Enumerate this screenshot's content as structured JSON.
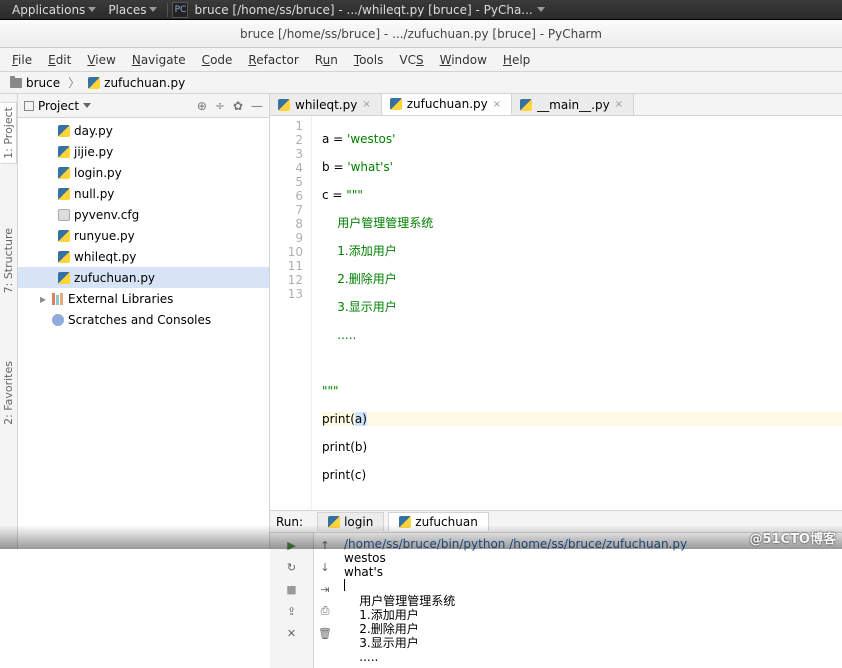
{
  "sysbar": {
    "applications": "Applications",
    "places": "Places",
    "wintitle": "bruce [/home/ss/bruce] - .../whileqt.py [bruce] - PyCha..."
  },
  "titlebar": "bruce [/home/ss/bruce] - .../zufuchuan.py [bruce] - PyCharm",
  "menu": [
    "File",
    "Edit",
    "View",
    "Navigate",
    "Code",
    "Refactor",
    "Run",
    "Tools",
    "VCS",
    "Window",
    "Help"
  ],
  "breadcrumb": {
    "root": "bruce",
    "file": "zufuchuan.py"
  },
  "vtabs": {
    "project": "1: Project",
    "structure": "7: Structure",
    "favorites": "2: Favorites"
  },
  "project": {
    "title": "Project",
    "items": [
      {
        "icon": "py",
        "label": "day.py"
      },
      {
        "icon": "py",
        "label": "jijie.py"
      },
      {
        "icon": "py",
        "label": "login.py"
      },
      {
        "icon": "py",
        "label": "null.py"
      },
      {
        "icon": "cfg",
        "label": "pyvenv.cfg"
      },
      {
        "icon": "py",
        "label": "runyue.py"
      },
      {
        "icon": "py",
        "label": "whileqt.py"
      },
      {
        "icon": "py",
        "label": "zufuchuan.py",
        "selected": true
      }
    ],
    "ext_lib": "External Libraries",
    "scratches": "Scratches and Consoles"
  },
  "editor_tabs": [
    {
      "label": "whileqt.py"
    },
    {
      "label": "zufuchuan.py",
      "active": true
    },
    {
      "label": "__main__.py"
    }
  ],
  "code": {
    "lines": [
      "1",
      "2",
      "3",
      "4",
      "5",
      "6",
      "7",
      "8",
      "9",
      "10",
      "11",
      "12",
      "13"
    ],
    "l1a": "a ",
    "l1b": "= ",
    "l1c": "'westos'",
    "l2a": "b ",
    "l2b": "= ",
    "l2c": "'what's'",
    "l3a": "c ",
    "l3b": "= ",
    "l3c": "\"\"\"",
    "l4": "    用户管理管理系统",
    "l5": "    1.添加用户",
    "l6": "    2.删除用户",
    "l7": "    3.显示用户",
    "l8": "    .....",
    "l10": "\"\"\"",
    "l11a": "print",
    "l11b": "(",
    "l11c": "a",
    "l11d": ")",
    "l12a": "print",
    "l12b": "(b)",
    "l13a": "print",
    "l13b": "(c)"
  },
  "run": {
    "label": "Run:",
    "tabs": [
      {
        "label": "login"
      },
      {
        "label": "zufuchuan",
        "active": true
      }
    ],
    "cmd": "/home/ss/bruce/bin/python /home/ss/bruce/zufuchuan.py",
    "out": [
      "westos",
      "what's",
      "",
      "    用户管理管理系统",
      "    1.添加用户",
      "    2.删除用户",
      "    3.显示用户",
      "    ....."
    ]
  },
  "watermark": "@51CTO博客"
}
